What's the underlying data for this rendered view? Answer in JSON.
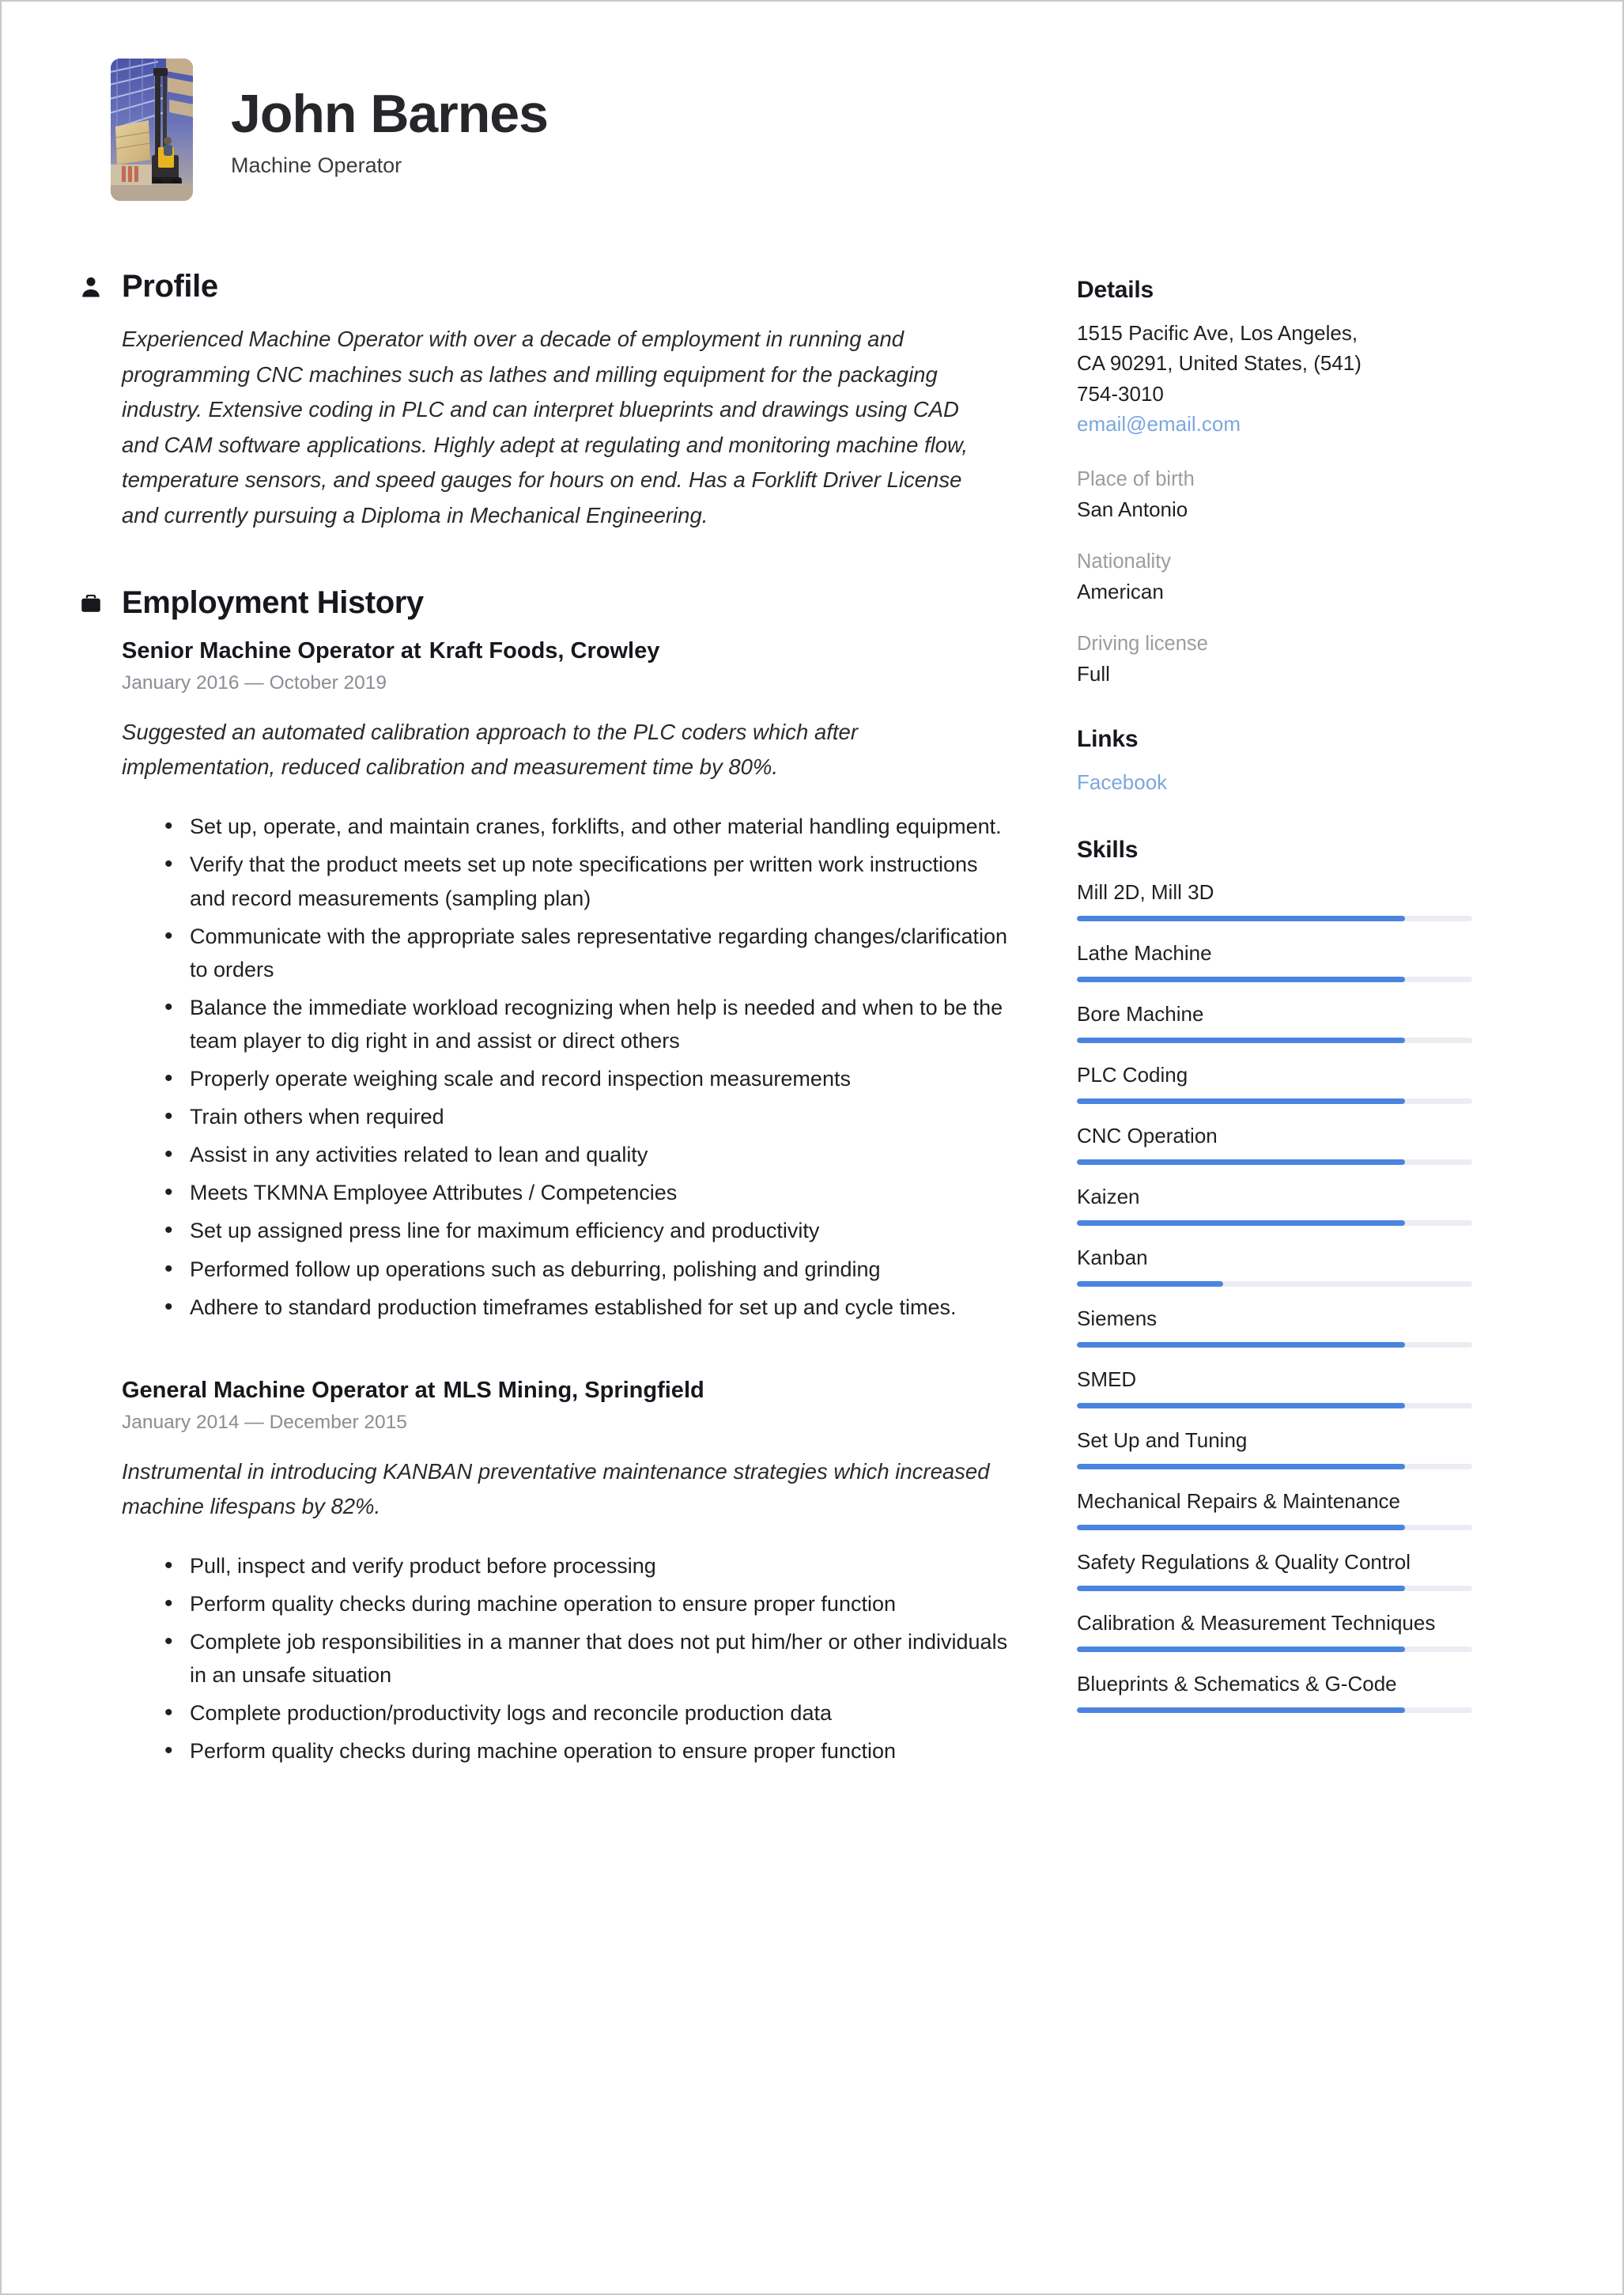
{
  "header": {
    "name": "John Barnes",
    "job_title": "Machine Operator",
    "photo_alt": "warehouse-forklift-photo"
  },
  "profile": {
    "heading": "Profile",
    "icon": "person-icon",
    "text": "Experienced Machine Operator with over a decade of employment in running and programming CNC machines such as lathes and milling equipment for the packaging industry. Extensive coding in PLC and can interpret blueprints and drawings using CAD and CAM software applications. Highly adept at regulating and monitoring machine flow, temperature sensors, and speed gauges for hours on end. Has a Forklift Driver License and currently pursuing a Diploma in Mechanical Engineering."
  },
  "employment": {
    "heading": "Employment History",
    "icon": "briefcase-icon",
    "jobs": [
      {
        "role": "Senior Machine Operator at",
        "company": "Kraft Foods, Crowley",
        "dates": "January 2016 — October 2019",
        "summary": "Suggested an automated calibration approach to the PLC coders which after implementation, reduced calibration and measurement time by 80%.",
        "bullets": [
          "Set up, operate, and maintain cranes, forklifts, and other material handling equipment.",
          "Verify that the product meets set up note specifications per written work instructions and record measurements (sampling plan)",
          "Communicate with the appropriate sales representative regarding changes/clarification to orders",
          "Balance the immediate workload recognizing when help is needed and when to be the team player to dig right in and assist or direct others",
          "Properly operate weighing scale and record inspection measurements",
          "Train others when required",
          "Assist in any activities related to lean and quality",
          "Meets TKMNA Employee Attributes / Competencies",
          "Set up assigned press line for maximum efficiency and productivity",
          "Performed follow up operations such as deburring, polishing and grinding",
          "Adhere to standard production timeframes established for set up and cycle times."
        ]
      },
      {
        "role": "General Machine Operator at",
        "company": "MLS Mining, Springfield",
        "dates": "January 2014 — December 2015",
        "summary": "Instrumental in introducing KANBAN preventative maintenance strategies which increased machine lifespans by 82%.",
        "bullets": [
          "Pull, inspect and verify product before processing",
          "Perform quality checks during machine operation to ensure proper function",
          "Complete job responsibilities in a manner that does not put him/her or other individuals in an unsafe situation",
          "Complete production/productivity logs and reconcile production data",
          "Perform quality checks during machine operation to ensure proper function"
        ]
      }
    ]
  },
  "details": {
    "heading": "Details",
    "address_lines": [
      "1515 Pacific Ave, Los Angeles,",
      "CA 90291, United States, (541)",
      "754-3010"
    ],
    "email": "email@email.com",
    "fields": [
      {
        "label": "Place of birth",
        "value": "San Antonio"
      },
      {
        "label": "Nationality",
        "value": "American"
      },
      {
        "label": "Driving license",
        "value": "Full"
      }
    ]
  },
  "links": {
    "heading": "Links",
    "items": [
      {
        "label": "Facebook"
      }
    ]
  },
  "skills": {
    "heading": "Skills",
    "items": [
      {
        "name": "Mill 2D, Mill 3D",
        "level": 83
      },
      {
        "name": "Lathe Machine",
        "level": 83
      },
      {
        "name": "Bore Machine",
        "level": 83
      },
      {
        "name": "PLC Coding",
        "level": 83
      },
      {
        "name": "CNC Operation",
        "level": 83
      },
      {
        "name": "Kaizen",
        "level": 83
      },
      {
        "name": "Kanban",
        "level": 37
      },
      {
        "name": "Siemens",
        "level": 83
      },
      {
        "name": "SMED",
        "level": 83
      },
      {
        "name": "Set Up and Tuning",
        "level": 83
      },
      {
        "name": "Mechanical Repairs & Maintenance",
        "level": 83
      },
      {
        "name": "Safety Regulations & Quality Control",
        "level": 83
      },
      {
        "name": "Calibration & Measurement Techniques",
        "level": 83
      },
      {
        "name": "Blueprints & Schematics & G-Code",
        "level": 83
      }
    ]
  },
  "colors": {
    "accent": "#4a84e0",
    "link": "#7ba7dd",
    "track": "#ebedf2",
    "muted": "#9a9ca1",
    "text": "#1f2024"
  }
}
